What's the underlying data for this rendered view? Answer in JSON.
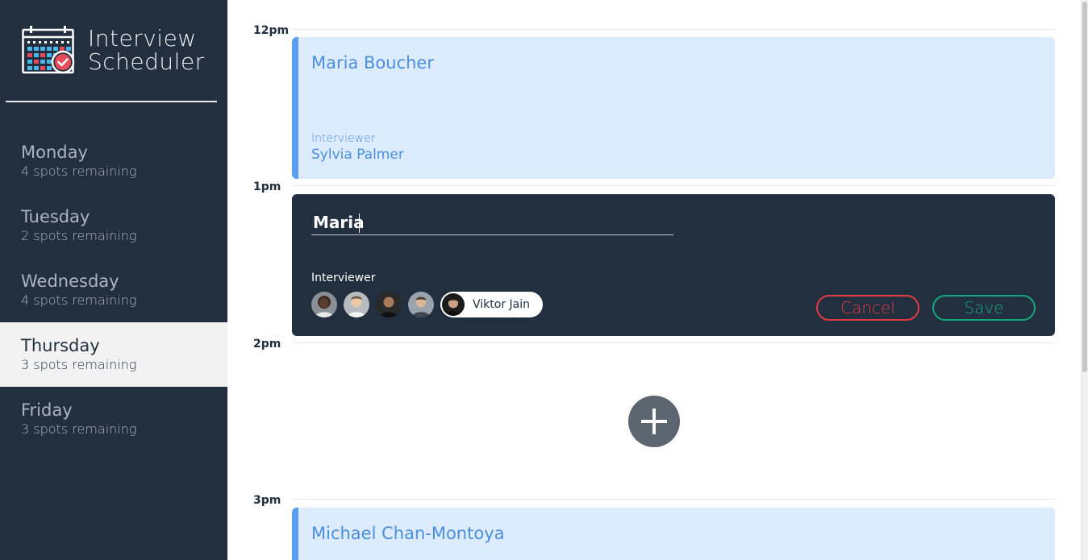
{
  "app": {
    "title_line1": "Interview",
    "title_line2": "Scheduler",
    "logo_icon": "calendar-check-icon"
  },
  "days": [
    {
      "name": "Monday",
      "spots": "4 spots remaining",
      "selected": false
    },
    {
      "name": "Tuesday",
      "spots": "2 spots remaining",
      "selected": false
    },
    {
      "name": "Wednesday",
      "spots": "4 spots remaining",
      "selected": false
    },
    {
      "name": "Thursday",
      "spots": "3 spots remaining",
      "selected": true
    },
    {
      "name": "Friday",
      "spots": "3 spots remaining",
      "selected": false
    }
  ],
  "schedule": {
    "times": [
      "12pm",
      "1pm",
      "2pm",
      "3pm"
    ],
    "appointments": [
      {
        "student": "Maria Boucher",
        "interviewer_label": "Interviewer",
        "interviewer": "Sylvia Palmer"
      },
      {
        "student": "Michael Chan-Montoya"
      }
    ],
    "form": {
      "name_value": "Maria",
      "interviewer_label": "Interviewer",
      "selected_interviewer": "Viktor Jain",
      "cancel_label": "Cancel",
      "save_label": "Save"
    },
    "add_icon": "plus-icon"
  },
  "colors": {
    "sidebar_bg": "#222f3e",
    "appointment_bg": "#dcebfd",
    "appointment_accent": "#5b9ef0",
    "cancel": "#e23b45",
    "save": "#18a67b"
  }
}
